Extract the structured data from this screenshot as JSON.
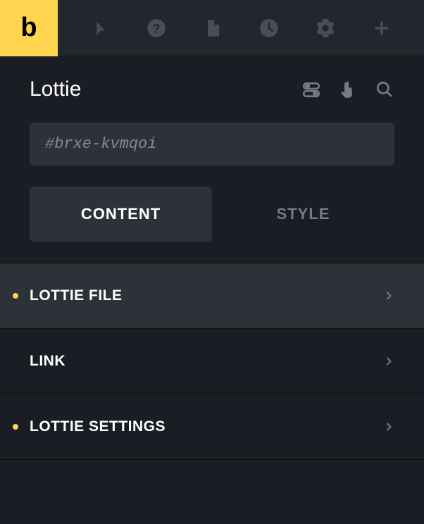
{
  "logo": "b",
  "title": "Lottie",
  "id_field": "#brxe-kvmqoi",
  "tabs": {
    "content": "CONTENT",
    "style": "STYLE"
  },
  "sections": [
    {
      "label": "LOTTIE FILE",
      "has_dot": true,
      "highlighted": true
    },
    {
      "label": "LINK",
      "has_dot": false,
      "highlighted": false
    },
    {
      "label": "LOTTIE SETTINGS",
      "has_dot": true,
      "highlighted": false
    }
  ]
}
